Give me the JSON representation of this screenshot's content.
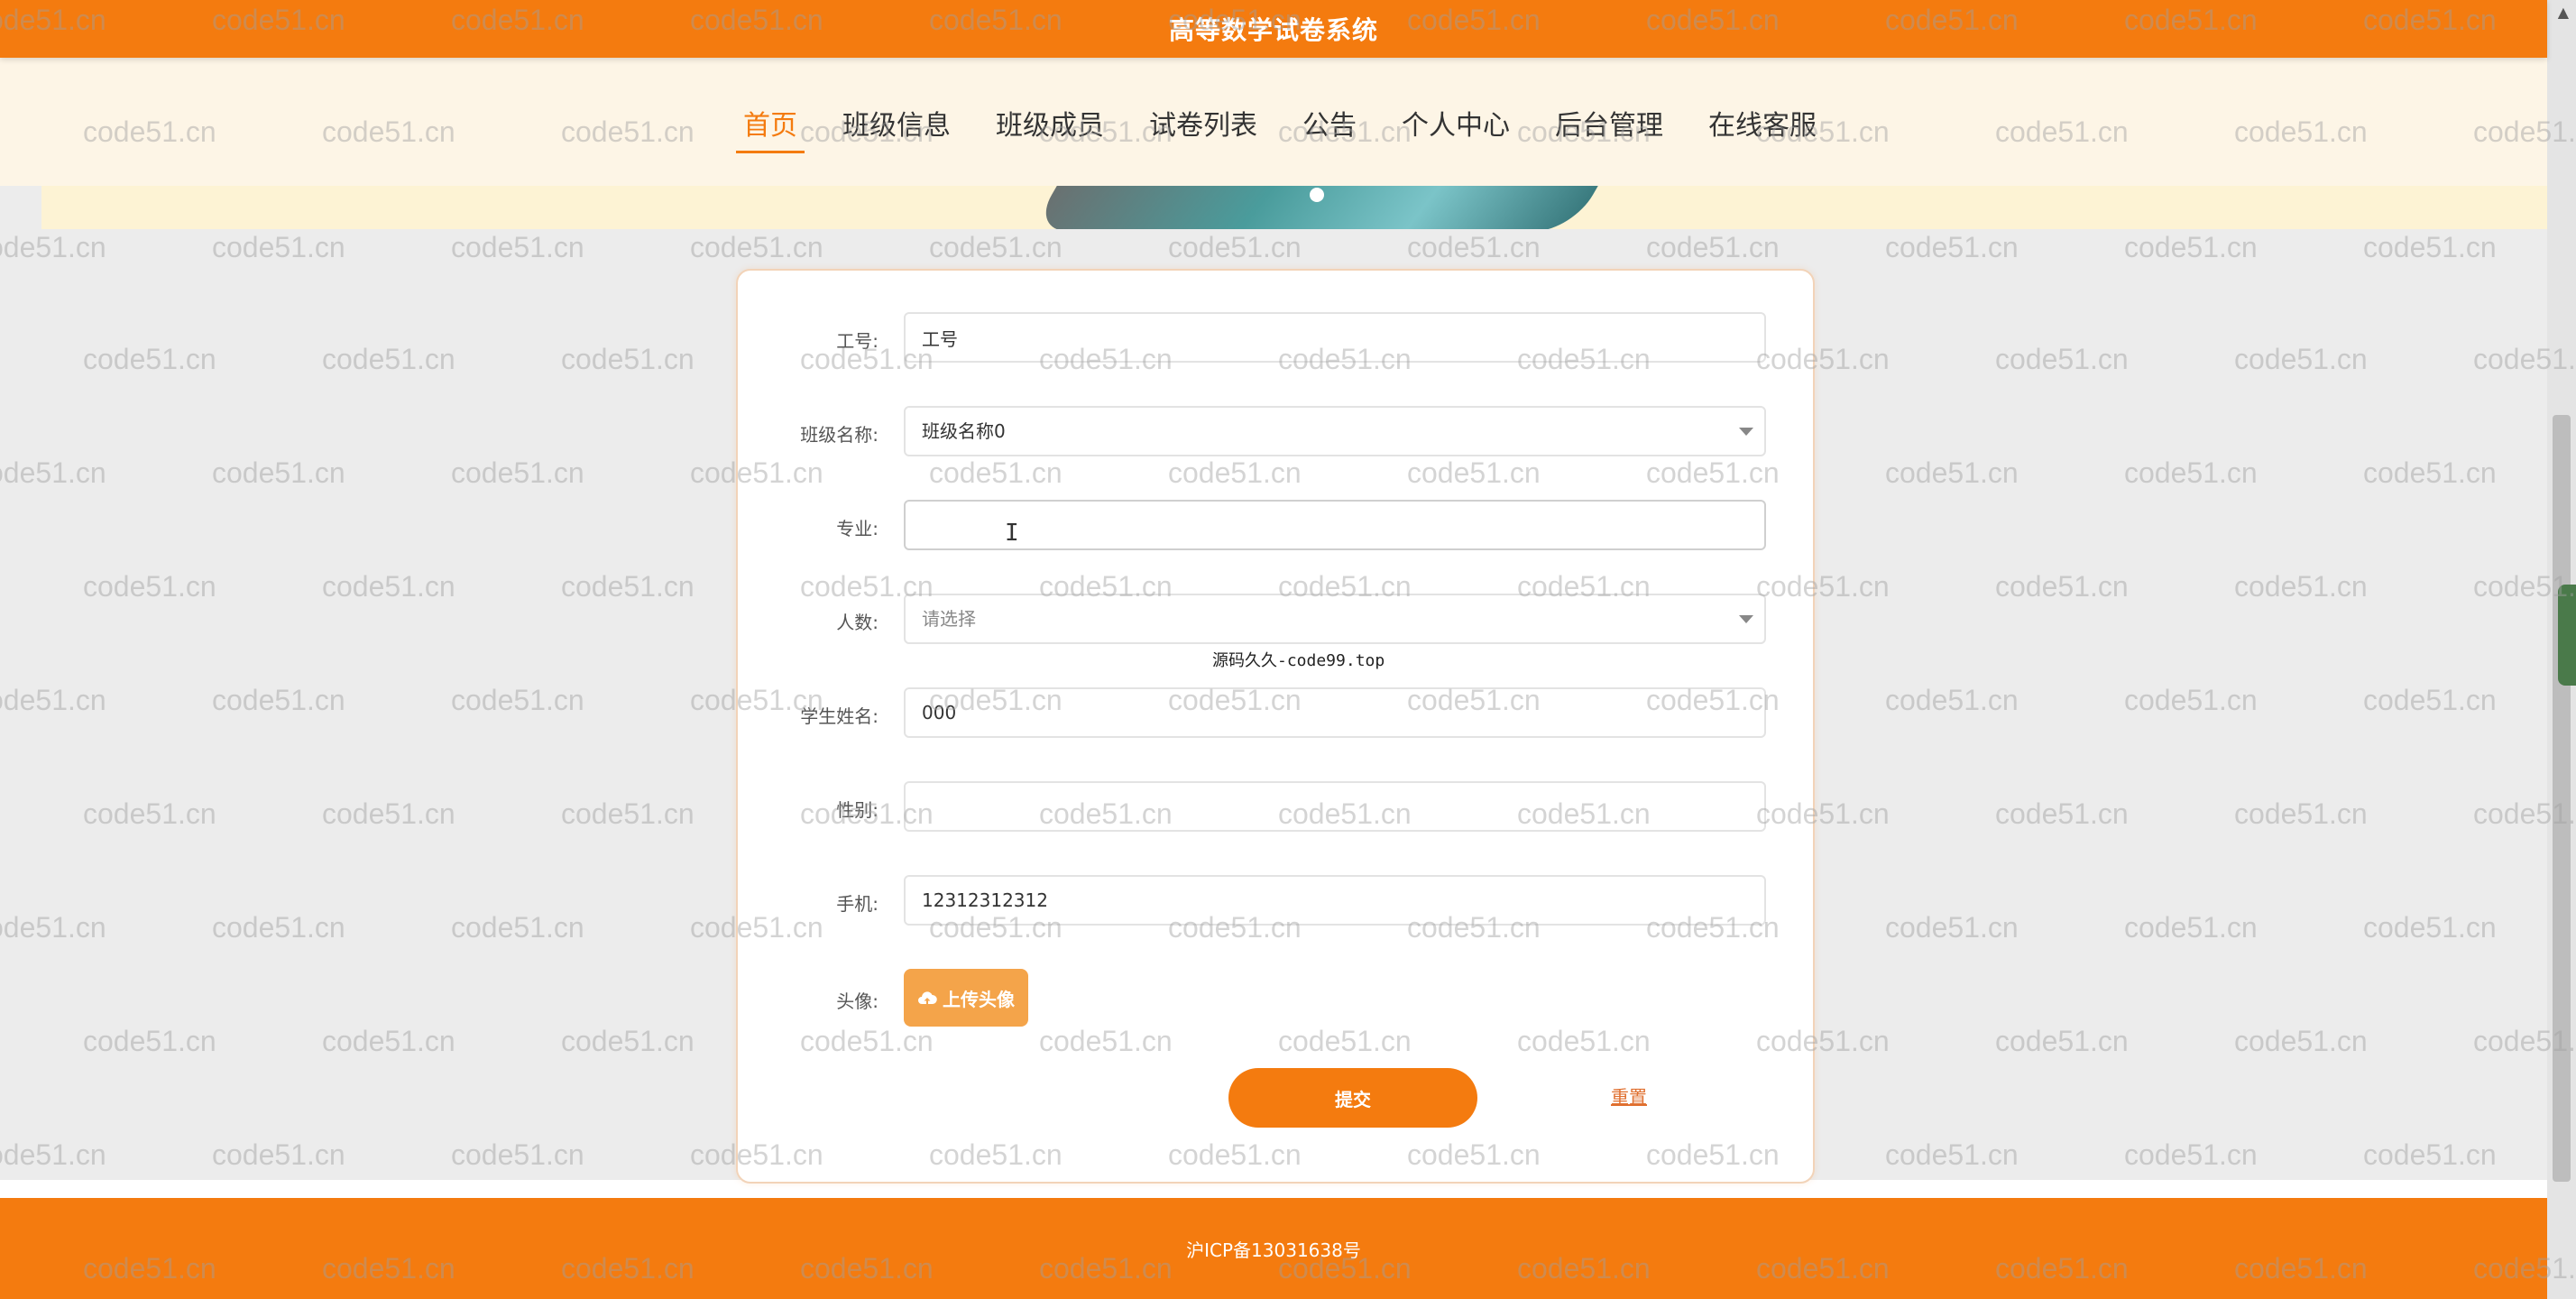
{
  "header": {
    "title": "高等数学试卷系统"
  },
  "nav": {
    "items": [
      {
        "label": "首页",
        "active": true
      },
      {
        "label": "班级信息",
        "active": false
      },
      {
        "label": "班级成员",
        "active": false
      },
      {
        "label": "试卷列表",
        "active": false
      },
      {
        "label": "公告",
        "active": false
      },
      {
        "label": "个人中心",
        "active": false
      },
      {
        "label": "后台管理",
        "active": false
      },
      {
        "label": "在线客服",
        "active": false
      }
    ]
  },
  "form": {
    "fields": {
      "gonghao": {
        "label": "工号:",
        "value": "工号"
      },
      "banjimingcheng": {
        "label": "班级名称:",
        "value": "班级名称0"
      },
      "zhuanye": {
        "label": "专业:",
        "value": ""
      },
      "renshu": {
        "label": "人数:",
        "placeholder": "请选择"
      },
      "xueshengxingming": {
        "label": "学生姓名:",
        "value": "000"
      },
      "xingbie": {
        "label": "性别:",
        "value": ""
      },
      "shouji": {
        "label": "手机:",
        "value": "12312312312"
      },
      "touxiang": {
        "label": "头像:",
        "button": "上传头像"
      }
    },
    "submit_label": "提交",
    "reset_label": "重置"
  },
  "overlay_text": "源码久久-code99.top",
  "footer": {
    "icp": "沪ICP备13031638号"
  },
  "watermark": "code51.cn",
  "colors": {
    "brand": "#f47b0f",
    "nav_bg": "#fdf5e6",
    "page_bg": "#ececec"
  },
  "icons": {
    "upload": "cloud-upload-icon",
    "select_arrow": "chevron-down-icon"
  }
}
